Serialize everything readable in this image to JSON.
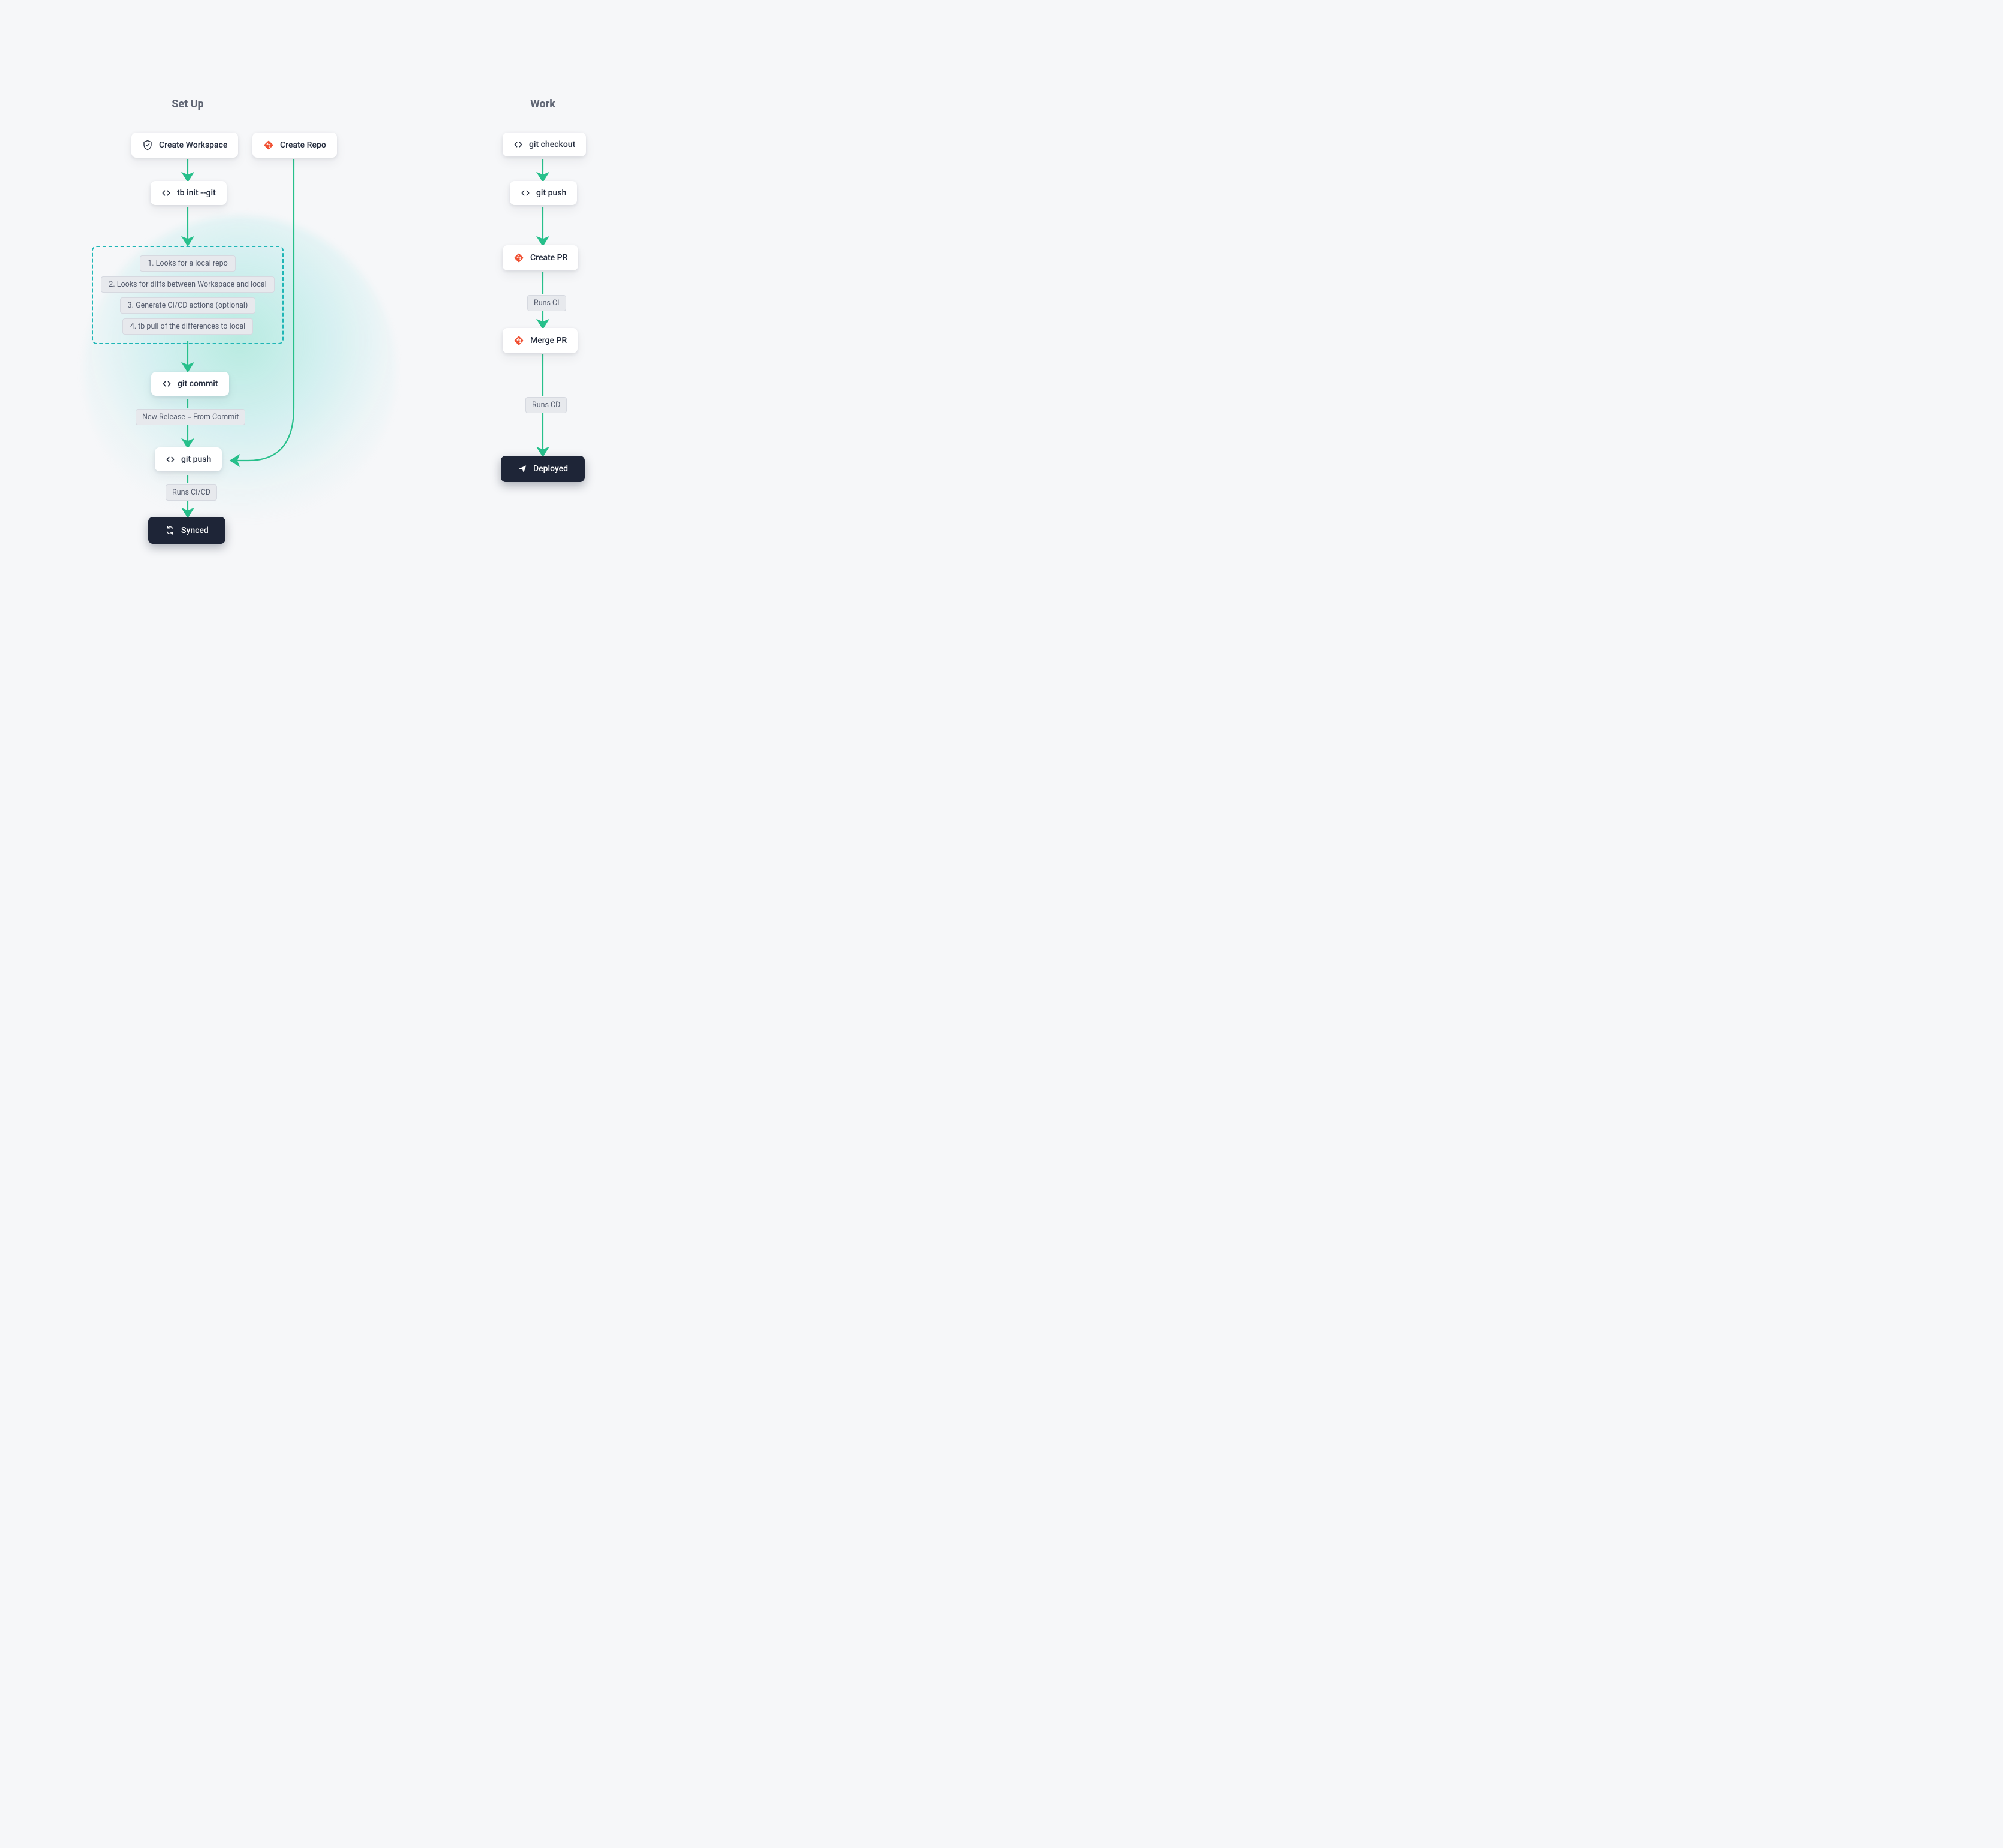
{
  "colors": {
    "arrow": "#27c08b",
    "git_brand": "#f05133",
    "dashed_border": "#1fb6b6",
    "bg": "#f6f7f9",
    "card_bg": "#ffffff",
    "dark_bg": "#1e2537"
  },
  "setup": {
    "heading": "Set Up",
    "create_workspace": {
      "label": "Create Workspace",
      "icon": "shield-check-icon"
    },
    "create_repo": {
      "label": "Create Repo",
      "icon": "git-icon"
    },
    "tb_init": {
      "label": "tb init --git",
      "icon": "code-icon"
    },
    "init_steps": {
      "step1": "1. Looks for a local repo",
      "step2": "2. Looks for diffs between Workspace and local",
      "step3": "3. Generate CI/CD actions (optional)",
      "step4": "4. tb pull of the differences to local"
    },
    "git_commit": {
      "label": "git commit",
      "icon": "code-icon"
    },
    "release_note": "New Release = From Commit",
    "git_push": {
      "label": "git push",
      "icon": "code-icon"
    },
    "runs_cicd": "Runs CI/CD",
    "synced": {
      "label": "Synced",
      "icon": "sync-icon"
    }
  },
  "work": {
    "heading": "Work",
    "git_checkout": {
      "label": "git checkout",
      "icon": "code-icon"
    },
    "git_push": {
      "label": "git push",
      "icon": "code-icon"
    },
    "create_pr": {
      "label": "Create PR",
      "icon": "git-icon"
    },
    "runs_ci": "Runs CI",
    "merge_pr": {
      "label": "Merge PR",
      "icon": "git-icon"
    },
    "runs_cd": "Runs CD",
    "deployed": {
      "label": "Deployed",
      "icon": "rocket-icon"
    }
  }
}
